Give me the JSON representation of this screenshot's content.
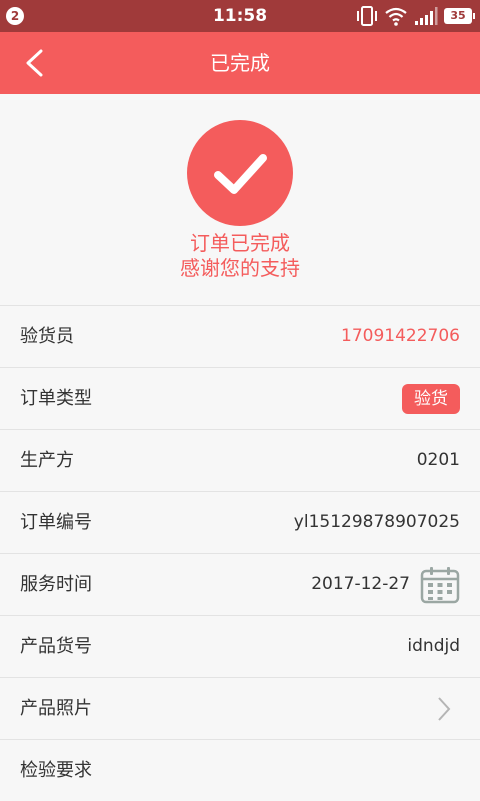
{
  "status_bar": {
    "notification_count": "2",
    "time": "11:58",
    "battery": "35",
    "icons": [
      "vibrate-icon",
      "wifi-icon",
      "signal-icon",
      "battery-icon"
    ]
  },
  "nav": {
    "back_icon": "chevron-left-icon",
    "title": "已完成"
  },
  "hero": {
    "icon": "check-icon",
    "line1": "订单已完成",
    "line2": "感谢您的支持"
  },
  "details": {
    "inspector": {
      "label": "验货员",
      "value": "17091422706"
    },
    "order_type": {
      "label": "订单类型",
      "value": "验货"
    },
    "producer": {
      "label": "生产方",
      "value": "0201"
    },
    "order_number": {
      "label": "订单编号",
      "value": "yl15129878907025"
    },
    "service_time": {
      "label": "服务时间",
      "value": "2017-12-27",
      "icon": "calendar-icon"
    },
    "product_number": {
      "label": "产品货号",
      "value": "idndjd"
    },
    "product_photos": {
      "label": "产品照片",
      "icon": "chevron-right-icon"
    },
    "inspection_requirements": {
      "label": "检验要求"
    }
  },
  "colors": {
    "accent": "#f45c5c",
    "status_bar": "#a03a3a",
    "background": "#f7f7f7",
    "divider": "#e3e3e3",
    "text": "#333333"
  }
}
